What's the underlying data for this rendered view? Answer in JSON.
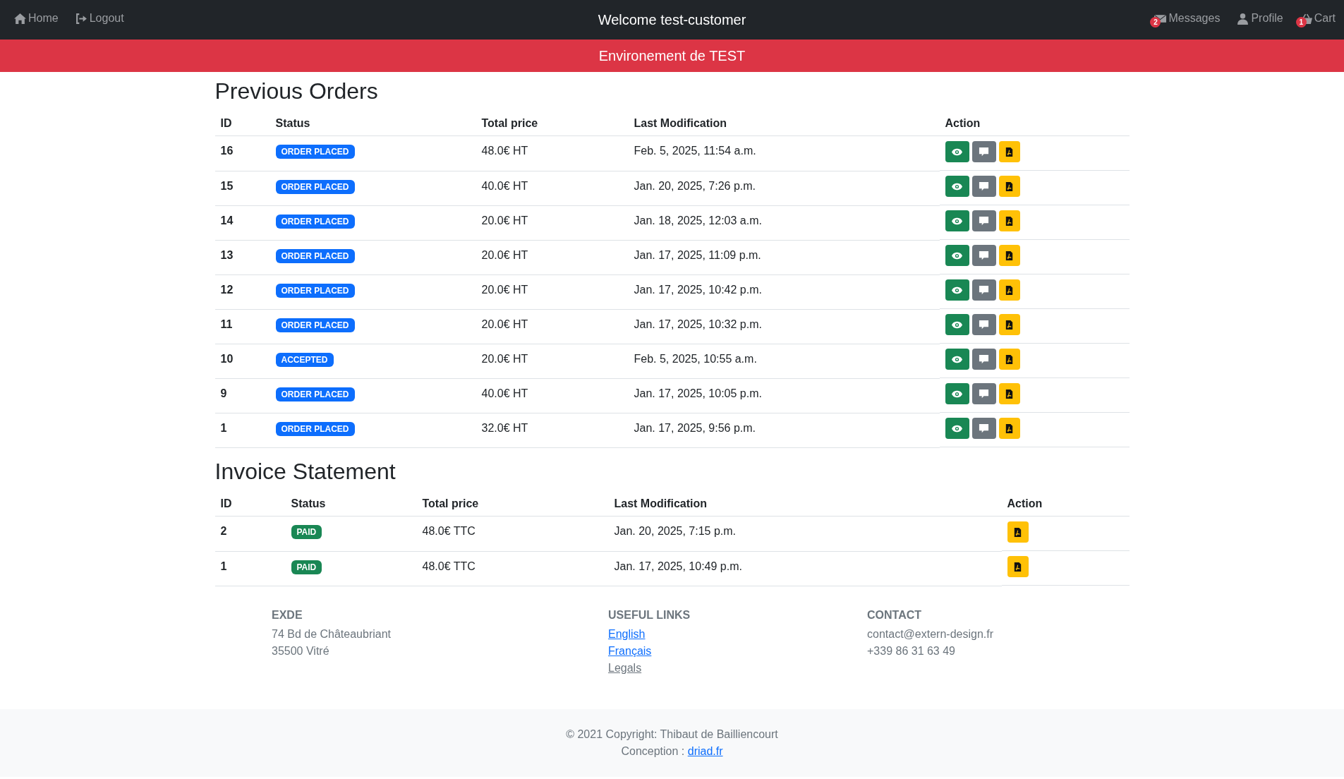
{
  "navbar": {
    "left": [
      {
        "label": "Home",
        "kind": "home"
      },
      {
        "label": "Logout",
        "kind": "logout"
      }
    ],
    "title": "Welcome test-customer",
    "right": [
      {
        "label": "Messages",
        "kind": "messages",
        "count": "2"
      },
      {
        "label": "Profile",
        "kind": "profile"
      },
      {
        "label": "Cart",
        "kind": "cart",
        "count": "1"
      }
    ]
  },
  "banner": "Environement de TEST",
  "orders": {
    "title": "Previous Orders",
    "columns": [
      "ID",
      "Status",
      "Total price",
      "Last Modification",
      "Action"
    ],
    "rows": [
      {
        "id": "16",
        "status": "ORDER PLACED",
        "color": "#0d6efd",
        "price": "48.0€ HT",
        "modified": "Feb. 5, 2025, 11:54 a.m."
      },
      {
        "id": "15",
        "status": "ORDER PLACED",
        "color": "#0d6efd",
        "price": "40.0€ HT",
        "modified": "Jan. 20, 2025, 7:26 p.m."
      },
      {
        "id": "14",
        "status": "ORDER PLACED",
        "color": "#0d6efd",
        "price": "20.0€ HT",
        "modified": "Jan. 18, 2025, 12:03 a.m."
      },
      {
        "id": "13",
        "status": "ORDER PLACED",
        "color": "#0d6efd",
        "price": "20.0€ HT",
        "modified": "Jan. 17, 2025, 11:09 p.m."
      },
      {
        "id": "12",
        "status": "ORDER PLACED",
        "color": "#0d6efd",
        "price": "20.0€ HT",
        "modified": "Jan. 17, 2025, 10:42 p.m."
      },
      {
        "id": "11",
        "status": "ORDER PLACED",
        "color": "#0d6efd",
        "price": "20.0€ HT",
        "modified": "Jan. 17, 2025, 10:32 p.m."
      },
      {
        "id": "10",
        "status": "ACCEPTED",
        "color": "#0d6efd",
        "price": "20.0€ HT",
        "modified": "Feb. 5, 2025, 10:55 a.m."
      },
      {
        "id": "9",
        "status": "ORDER PLACED",
        "color": "#0d6efd",
        "price": "40.0€ HT",
        "modified": "Jan. 17, 2025, 10:05 p.m."
      },
      {
        "id": "1",
        "status": "ORDER PLACED",
        "color": "#0d6efd",
        "price": "32.0€ HT",
        "modified": "Jan. 17, 2025, 9:56 p.m."
      }
    ]
  },
  "invoices": {
    "title": "Invoice Statement",
    "columns": [
      "ID",
      "Status",
      "Total price",
      "Last Modification",
      "Action"
    ],
    "rows": [
      {
        "id": "2",
        "status": "PAID",
        "color": "#198754",
        "price": "48.0€ TTC",
        "modified": "Jan. 20, 2025, 7:15 p.m."
      },
      {
        "id": "1",
        "status": "PAID",
        "color": "#198754",
        "price": "48.0€ TTC",
        "modified": "Jan. 17, 2025, 10:49 p.m."
      }
    ]
  },
  "footer": {
    "columns": [
      {
        "heading": "EXDE",
        "lines": [
          "74 Bd de Châteaubriant",
          "35500 Vitré"
        ]
      },
      {
        "heading": "USEFUL LINKS",
        "links": [
          {
            "label": "English",
            "color": "#0d6efd"
          },
          {
            "label": "Français",
            "color": "#0d6efd"
          },
          {
            "label": "Legals",
            "color": "#6c757d"
          }
        ]
      },
      {
        "heading": "CONTACT",
        "lines": [
          "contact@extern-design.fr",
          "+339 86 31 63 49"
        ]
      }
    ],
    "copyright": "© 2021 Copyright: Thibaut de Bailliencourt",
    "conception": "Conception :",
    "conception_link": "driad.fr"
  }
}
